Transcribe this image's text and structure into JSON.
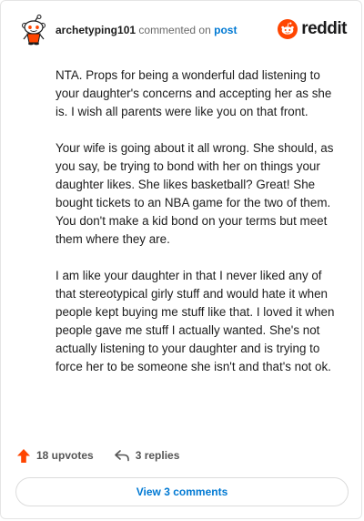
{
  "comment": {
    "username": "archetyping101",
    "action_text": "commented on",
    "post_link": "post",
    "paragraphs": [
      "NTA. Props for being a wonderful dad listening to your daughter's concerns and accepting her as she is. I wish all parents were like you on that front.",
      "Your wife is going about it all wrong. She should, as you say, be trying to bond with her on things your daughter likes. She likes basketball? Great! She bought tickets to an NBA game for the two of them. You don't make a kid bond on your terms but meet them where they are.",
      "I am like your daughter in that I never liked any of that stereotypical girly stuff and would hate it when people kept buying me stuff like that. I loved it when people gave me stuff I actually wanted. She's not actually listening to your daughter and is trying to force her to be someone she isn't and that's not ok."
    ]
  },
  "brand": {
    "name": "reddit",
    "color": "#ff4500",
    "icon": "reddit-logo-icon"
  },
  "actions": {
    "upvotes_label": "18 upvotes",
    "replies_label": "3 replies",
    "upvote_icon": "upvote-arrow-icon",
    "upvote_color": "#ff4500",
    "reply_icon": "reply-arrow-icon"
  },
  "view_button": {
    "label": "View 3 comments"
  },
  "colors": {
    "link": "#0079d3",
    "muted": "#6a6a6a"
  }
}
